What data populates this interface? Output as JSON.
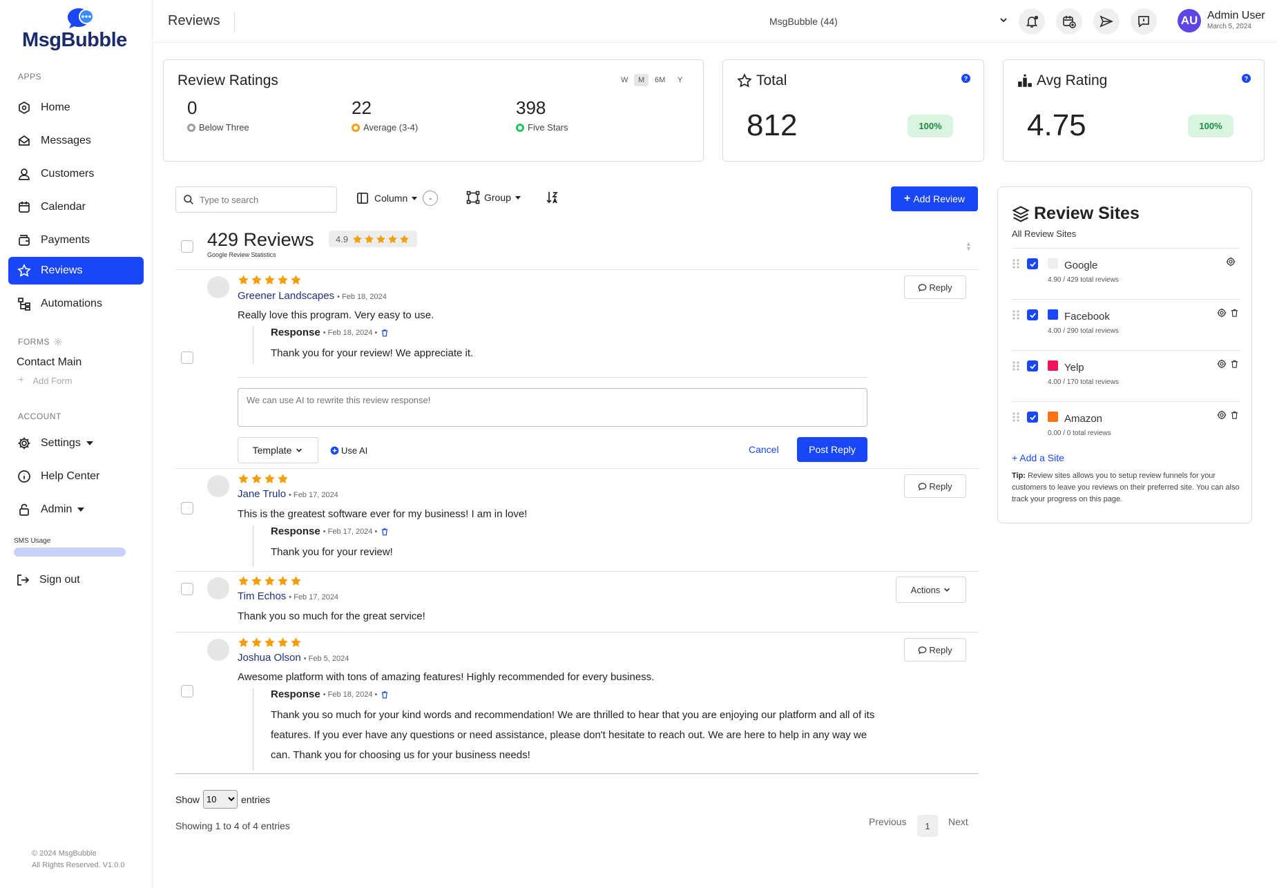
{
  "brand": {
    "name": "MsgBubble"
  },
  "sidebar": {
    "apps_label": "APPS",
    "items": [
      {
        "label": "Home",
        "icon": "home-icon"
      },
      {
        "label": "Messages",
        "icon": "envelope-icon"
      },
      {
        "label": "Customers",
        "icon": "user-icon"
      },
      {
        "label": "Calendar",
        "icon": "calendar-icon"
      },
      {
        "label": "Payments",
        "icon": "wallet-icon"
      },
      {
        "label": "Reviews",
        "icon": "star-icon",
        "active": true
      },
      {
        "label": "Automations",
        "icon": "flow-icon"
      }
    ],
    "forms_label": "FORMS",
    "forms": [
      {
        "label": "Contact Main"
      }
    ],
    "add_form": "Add Form",
    "account_label": "ACCOUNT",
    "account_items": [
      {
        "label": "Settings",
        "icon": "gear-icon"
      },
      {
        "label": "Help Center",
        "icon": "info-icon"
      },
      {
        "label": "Admin",
        "icon": "lock-icon"
      }
    ],
    "sms_usage_label": "SMS Usage",
    "sign_out": "Sign out",
    "copyright_line1": "© 2024 MsgBubble",
    "copyright_line2": "All Rights Reserved. V1.0.0"
  },
  "header": {
    "title": "Reviews",
    "account_selector": "MsgBubble (44)",
    "user_initials": "AU",
    "user_name": "Admin User",
    "user_date": "March 5, 2024"
  },
  "ratings_card": {
    "title": "Review Ratings",
    "ranges": [
      "W",
      "M",
      "6M",
      "Y"
    ],
    "active_range": "M",
    "stats": [
      {
        "value": "0",
        "label": "Below Three",
        "color": "#9e9e9e"
      },
      {
        "value": "22",
        "label": "Average (3-4)",
        "color": "#f59e0b"
      },
      {
        "value": "398",
        "label": "Five Stars",
        "color": "#22c55e"
      }
    ]
  },
  "total_card": {
    "title": "Total",
    "value": "812",
    "percent": "100%"
  },
  "avg_card": {
    "title": "Avg Rating",
    "value": "4.75",
    "percent": "100%"
  },
  "toolbar": {
    "search_placeholder": "Type to search",
    "column_label": "Column",
    "column_minus": "-",
    "group_label": "Group",
    "add_review_label": "Add Review"
  },
  "reviews_header": {
    "count_label": "429 Reviews",
    "rating": "4.9",
    "subtitle": "Google Review Statistics"
  },
  "reviews": [
    {
      "name": "Greener Landscapes",
      "date": "Feb 18, 2024",
      "stars": 5,
      "text": "Really love this program. Very easy to use.",
      "response": {
        "label": "Response",
        "date": "Feb 18, 2024",
        "text": "Thank you for your review! We appreciate it."
      },
      "action": "Reply",
      "composer": {
        "placeholder": "We can use AI to rewrite this review response!",
        "template_label": "Template",
        "use_ai_label": "Use AI",
        "cancel_label": "Cancel",
        "post_label": "Post Reply"
      }
    },
    {
      "name": "Jane Trulo",
      "date": "Feb 17, 2024",
      "stars": 4,
      "text": "This is the greatest software ever for my business! I am in love!",
      "response": {
        "label": "Response",
        "date": "Feb 17, 2024",
        "text": "Thank you for your review!"
      },
      "action": "Reply"
    },
    {
      "name": "Tim Echos",
      "date": "Feb 17, 2024",
      "stars": 5,
      "text": "Thank you so much for the great service!",
      "action": "Actions"
    },
    {
      "name": "Joshua Olson",
      "date": "Feb 5, 2024",
      "stars": 5,
      "text": "Awesome platform with tons of amazing features! Highly recommended for every business.",
      "response": {
        "label": "Response",
        "date": "Feb 18, 2024",
        "text": "Thank you so much for your kind words and recommendation! We are thrilled to hear that you are enjoying our platform and all of its features. If you ever have any questions or need assistance, please don't hesitate to reach out. We are here to help in any way we can. Thank you for choosing us for your business needs!"
      },
      "action": "Reply"
    }
  ],
  "pagination": {
    "show_label": "Show",
    "entries_value": "10",
    "entries_label": "entries",
    "showing_text": "Showing 1 to 4 of 4 entries",
    "previous": "Previous",
    "current_page": "1",
    "next": "Next"
  },
  "review_sites": {
    "title": "Review Sites",
    "subtitle": "All Review Sites",
    "sites": [
      {
        "name": "Google",
        "stats": "4.90 / 429 total reviews",
        "color": "#eeeeee",
        "deletable": false
      },
      {
        "name": "Facebook",
        "stats": "4.00 / 290 total reviews",
        "color": "#1a47f5",
        "deletable": true
      },
      {
        "name": "Yelp",
        "stats": "4.00 / 170 total reviews",
        "color": "#f0145a",
        "deletable": true
      },
      {
        "name": "Amazon",
        "stats": "0.00 / 0 total reviews",
        "color": "#f97316",
        "deletable": true
      }
    ],
    "add_site_label": "+ Add a Site",
    "tip_label": "Tip:",
    "tip_text": " Review sites allows you to setup review funnels for your customers to leave you reviews on their preferred site. You can also track your progress on this page."
  },
  "colors": {
    "primary": "#1a47f5",
    "star": "#f59e0b",
    "success_bg": "#d9f5e2",
    "success_text": "#1a8b3c"
  }
}
